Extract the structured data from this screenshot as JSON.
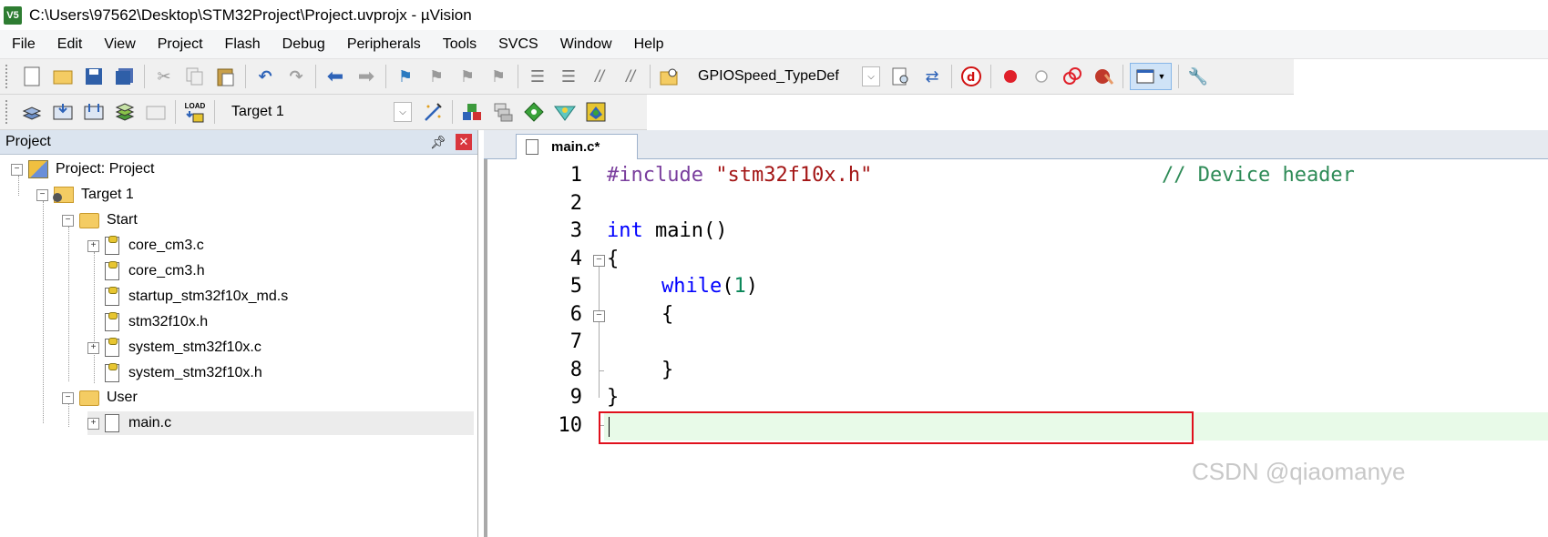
{
  "window": {
    "title": "C:\\Users\\97562\\Desktop\\STM32Project\\Project.uvprojx - µVision",
    "icon_label": "V5"
  },
  "menu": [
    "File",
    "Edit",
    "View",
    "Project",
    "Flash",
    "Debug",
    "Peripherals",
    "Tools",
    "SVCS",
    "Window",
    "Help"
  ],
  "toolbar1": {
    "icons": [
      "new-file-icon",
      "open-folder-icon",
      "save-icon",
      "save-all-icon",
      "cut-icon",
      "copy-icon",
      "paste-icon",
      "undo-icon",
      "redo-icon",
      "nav-back-icon",
      "nav-forward-icon",
      "bookmark-icon",
      "bookmark-prev-icon",
      "bookmark-next-icon",
      "bookmark-clear-icon",
      "indent-icon",
      "unindent-icon",
      "comment-icon",
      "uncomment-icon",
      "find-in-files-icon"
    ],
    "find_combo": "GPIOSpeed_TypeDef",
    "icons_right": [
      "find-icon",
      "incremental-find-icon",
      "debug-icon",
      "breakpoint-icon",
      "disable-breakpoint-icon",
      "kill-breakpoints-icon",
      "clear-breakpoints-icon",
      "window-layout-icon",
      "configure-icon"
    ]
  },
  "toolbar2": {
    "icons": [
      "translate-icon",
      "build-icon",
      "rebuild-icon",
      "batch-build-icon",
      "stop-build-icon",
      "load-icon"
    ],
    "load_label": "LOAD",
    "target_combo": "Target 1",
    "icons_right": [
      "target-options-icon",
      "manage-components-icon",
      "select-packs-icon",
      "run-time-env-icon",
      "pack-installer-icon",
      "multi-project-icon"
    ]
  },
  "project_panel": {
    "title": "Project",
    "tree": {
      "root": "Project: Project",
      "target": "Target 1",
      "groups": [
        {
          "name": "Start",
          "files": [
            "core_cm3.c",
            "core_cm3.h",
            "startup_stm32f10x_md.s",
            "stm32f10x.h",
            "system_stm32f10x.c",
            "system_stm32f10x.h"
          ]
        },
        {
          "name": "User",
          "files": [
            "main.c"
          ]
        }
      ]
    }
  },
  "editor": {
    "tab_label": "main.c*",
    "line_numbers": [
      "1",
      "2",
      "3",
      "4",
      "5",
      "6",
      "7",
      "8",
      "9",
      "10"
    ],
    "code": {
      "l1_directive": "#include",
      "l1_string": " \"stm32f10x.h\"",
      "l1_comment": "// Device header",
      "l3_type": "int",
      "l3_rest": " main()",
      "l4": "{",
      "l5_kw": "while",
      "l5_open": "(",
      "l5_num": "1",
      "l5_close": ")",
      "l6": "{",
      "l8": "}",
      "l9": "}"
    }
  },
  "watermark": "CSDN @qiaomanye",
  "colors": {
    "keyword": "#0000ff",
    "preprocessor": "#7a3e9d",
    "string": "#a31515",
    "comment": "#2e8b57",
    "number": "#098658",
    "current_line": "#e8fae8",
    "highlight_box": "#e0101c"
  }
}
